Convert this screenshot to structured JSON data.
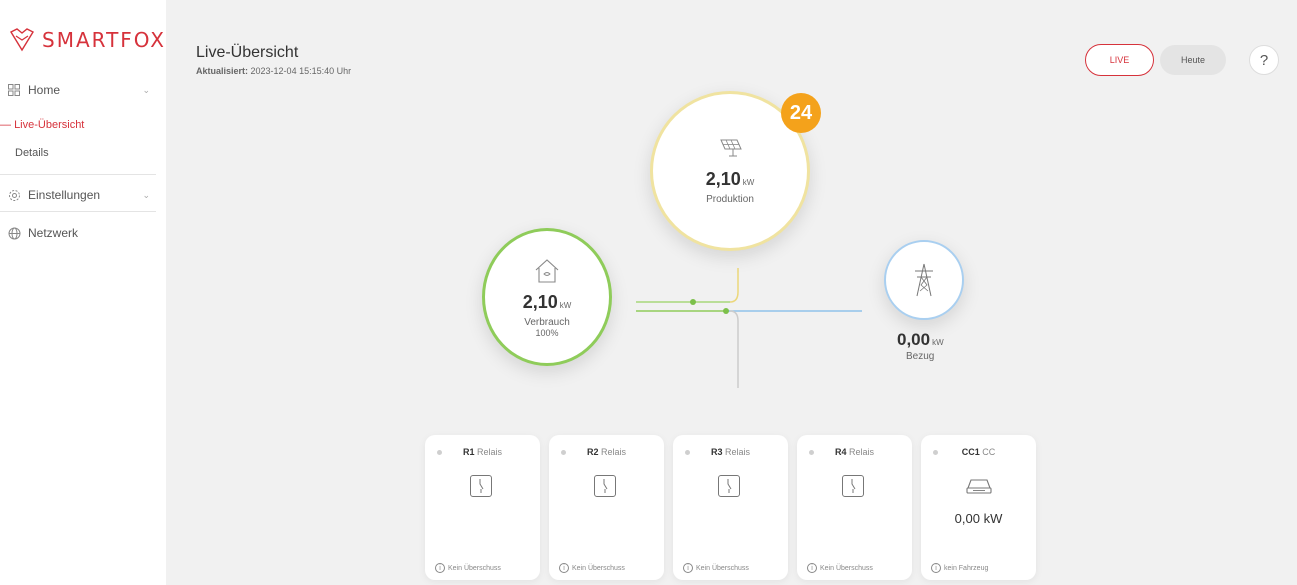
{
  "brand": {
    "name": "SMARTFOX",
    "accent": "#d6323b"
  },
  "sidebar": {
    "home": "Home",
    "live": "Live-Übersicht",
    "details": "Details",
    "settings": "Einstellungen",
    "network": "Netzwerk"
  },
  "header": {
    "title": "Live-Übersicht",
    "updated_label": "Aktualisiert:",
    "updated_value": "2023-12-04 15:15:40 Uhr",
    "btn_live": "LIVE",
    "btn_today": "Heute",
    "btn_help": "?"
  },
  "production": {
    "value": "2,10",
    "unit": "kW",
    "label": "Produktion",
    "badge": "24"
  },
  "consumption": {
    "value": "2,10",
    "unit": "kW",
    "label": "Verbrauch",
    "percent": "100%"
  },
  "grid": {
    "value": "0,00",
    "unit": "kW",
    "label": "Bezug"
  },
  "cards": [
    {
      "id": "R1",
      "type": "Relais",
      "footer": "Kein Überschuss"
    },
    {
      "id": "R2",
      "type": "Relais",
      "footer": "Kein Überschuss"
    },
    {
      "id": "R3",
      "type": "Relais",
      "footer": "Kein Überschuss"
    },
    {
      "id": "R4",
      "type": "Relais",
      "footer": "Kein Überschuss"
    },
    {
      "id": "CC1",
      "type": "CC",
      "value": "0,00",
      "unit": "kW",
      "footer": "kein Fahrzeug"
    }
  ]
}
